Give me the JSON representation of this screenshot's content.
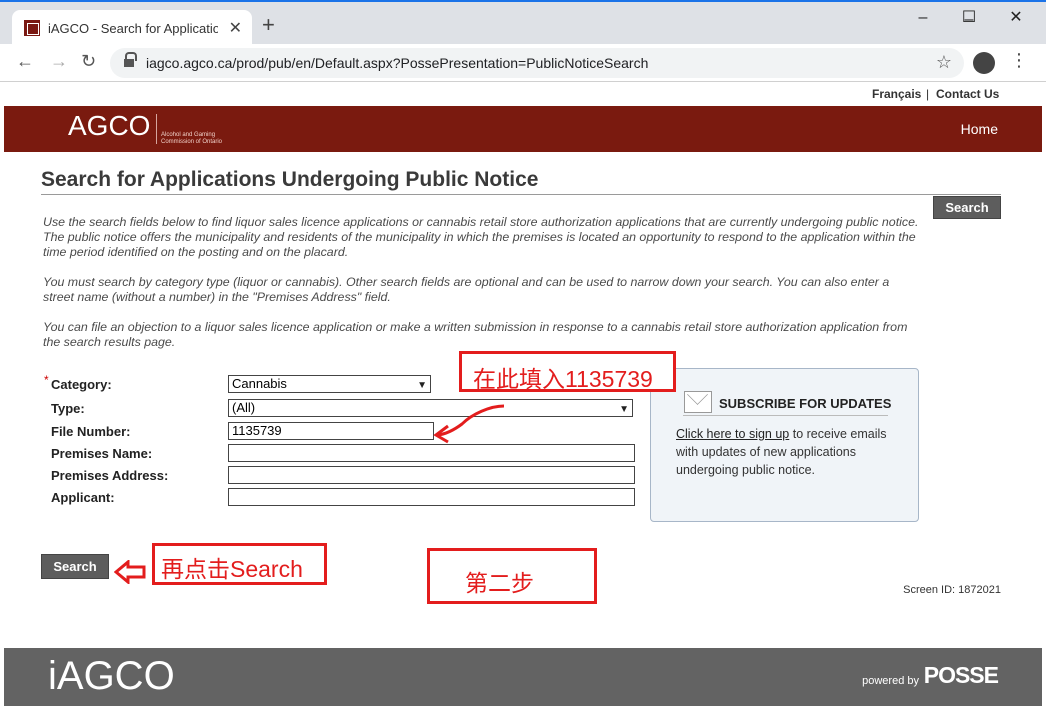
{
  "browser": {
    "tab_title": "iAGCO - Search for Applications U",
    "new_tab": "+",
    "url": "iagco.agco.ca/prod/pub/en/Default.aspx?PossePresentation=PublicNoticeSearch",
    "win_min": "–",
    "win_max": "☐",
    "win_close": "✕",
    "back": "←",
    "forward": "→",
    "reload": "↻",
    "star": "☆",
    "menu": "⋮",
    "close_tab": "✕"
  },
  "toplinks": {
    "francais": "Français",
    "separator": "|",
    "contact": "Contact Us"
  },
  "banner": {
    "logo": "AGCO",
    "logo_sub": "Alcohol and Gaming Commission of Ontario",
    "home": "Home"
  },
  "page": {
    "title": "Search for Applications Undergoing Public Notice",
    "search_button": "Search",
    "intro_1": "Use the search fields below to find liquor sales licence applications or cannabis retail store authorization applications that are currently undergoing public notice. The public notice offers the municipality and residents of the municipality in which the premises is located an opportunity to respond to the application within the time period identified on the posting and on the placard.",
    "intro_2": "You must search by category type (liquor or cannabis). Other search fields are optional and can be used to narrow down your search. You can also enter a street name (without a number) in the \"Premises Address\" field.",
    "intro_3": "You can file an objection to a liquor sales licence application or make a written submission in response to a cannabis retail store authorization application from the search results page."
  },
  "form": {
    "required_mark": "*",
    "category_label": "Category:",
    "category_value": "Cannabis",
    "type_label": "Type:",
    "type_value": "(All)",
    "file_number_label": "File Number:",
    "file_number_value": "1135739",
    "premises_name_label": "Premises Name:",
    "premises_name_value": "",
    "premises_address_label": "Premises Address:",
    "premises_address_value": "",
    "applicant_label": "Applicant:",
    "applicant_value": "",
    "search_button": "Search"
  },
  "subscribe": {
    "title": "SUBSCRIBE FOR UPDATES",
    "link_text": "Click here to sign up",
    "body_text": " to receive emails with updates of new applications undergoing public notice."
  },
  "annotations": {
    "fill_here": "在此填入1135739",
    "click_search": "再点击Search",
    "step_two": "第二步",
    "color": "#e31d1d"
  },
  "screen_id": "Screen ID: 1872021",
  "footer": {
    "logo": "iAGCO",
    "powered_by": "powered by",
    "posse": "POSSE"
  },
  "colors": {
    "banner": "#7a1a0f",
    "footer": "#636363",
    "button": "#5d5d5d"
  }
}
